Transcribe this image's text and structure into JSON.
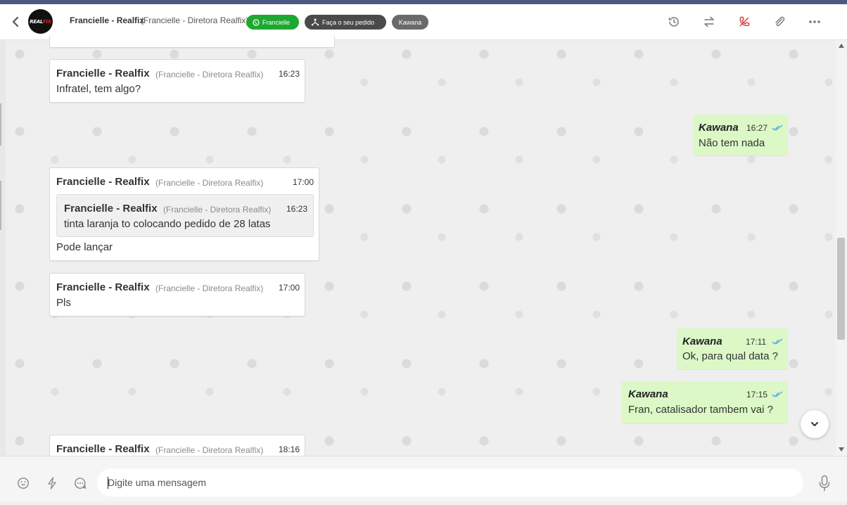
{
  "header": {
    "avatar_text_a": "REAL",
    "avatar_text_b": "FIX",
    "contact_name": "Francielle - Realfix",
    "contact_role": "(Francielle - Diretora Realfix)",
    "tags": {
      "whatsapp": "Francielle",
      "order": "Faça o seu pedido",
      "agent": "Kawana"
    },
    "icons": [
      "back-icon",
      "history-icon",
      "transfer-icon",
      "hangup-icon",
      "attach-icon",
      "more-icon"
    ]
  },
  "messages": [
    {
      "sender": "Francielle - Realfix",
      "role": "(Francielle - Diretora Realfix)",
      "time": "16:23",
      "text": "Infratel, tem algo?"
    },
    {
      "sender": "Kawana",
      "time": "16:27",
      "text": "Não tem nada"
    },
    {
      "sender": "Francielle - Realfix",
      "role": "(Francielle - Diretora Realfix)",
      "time": "17:00",
      "text": "Pode lançar",
      "quote": {
        "sender": "Francielle - Realfix",
        "role": "(Francielle - Diretora Realfix)",
        "time": "16:23",
        "text": "tinta laranja to colocando pedido de 28 latas"
      }
    },
    {
      "sender": "Francielle - Realfix",
      "role": "(Francielle - Diretora Realfix)",
      "time": "17:00",
      "text": "Pls"
    },
    {
      "sender": "Kawana",
      "time": "17:11",
      "text": "Ok, para qual data ?"
    },
    {
      "sender": "Kawana",
      "time": "17:15",
      "text": "Fran, catalisador tambem vai ?"
    },
    {
      "sender": "Francielle - Realfix",
      "role": "(Francielle - Diretora Realfix)",
      "time": "18:16"
    }
  ],
  "composer": {
    "placeholder": "Digite uma mensagem",
    "icons": [
      "emoji-icon",
      "lightning-icon",
      "quick-reply-icon",
      "microphone-icon"
    ]
  },
  "colors": {
    "outgoing_bubble": "#dcf8c6",
    "incoming_bubble": "#ffffff",
    "whatsapp_tag": "#1da832",
    "read_ticks": "#4fa3e0",
    "hangup": "#d93a3a"
  }
}
